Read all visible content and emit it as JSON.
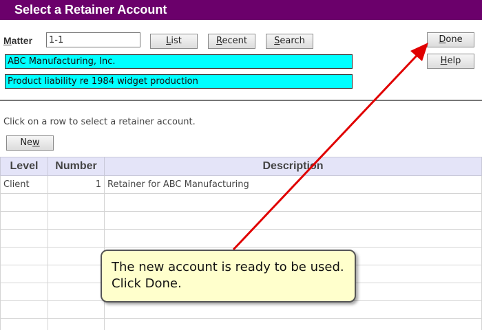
{
  "window": {
    "title": "Select a Retainer Account"
  },
  "matter": {
    "label_prefix": "M",
    "label_rest": "atter",
    "value": "1-1"
  },
  "buttons": {
    "list": {
      "prefix": "",
      "accel": "L",
      "rest": "ist"
    },
    "recent": {
      "prefix": "",
      "accel": "R",
      "rest": "ecent"
    },
    "search": {
      "prefix": "",
      "accel": "S",
      "rest": "earch"
    },
    "done": {
      "prefix": "",
      "accel": "D",
      "rest": "one"
    },
    "help": {
      "prefix": "",
      "accel": "H",
      "rest": "elp"
    },
    "new": {
      "prefix": "Ne",
      "accel": "w",
      "rest": ""
    }
  },
  "client_name": "ABC Manufacturing, Inc.",
  "matter_description": "Product liability re 1984 widget production",
  "instruction": "Click on a row to select a retainer account.",
  "table": {
    "columns": [
      "Level",
      "Number",
      "Description"
    ],
    "rows": [
      {
        "level": "Client",
        "number": "1",
        "description": "Retainer for ABC Manufacturing"
      }
    ],
    "empty_rows": 8
  },
  "callout": {
    "text": "The new account is ready to be used. Click Done."
  },
  "colors": {
    "titlebar": "#6b006b",
    "highlight_field": "#00ffff",
    "table_header": "#e4e4f8",
    "callout_bg": "#ffffcc",
    "arrow": "#e00000"
  }
}
